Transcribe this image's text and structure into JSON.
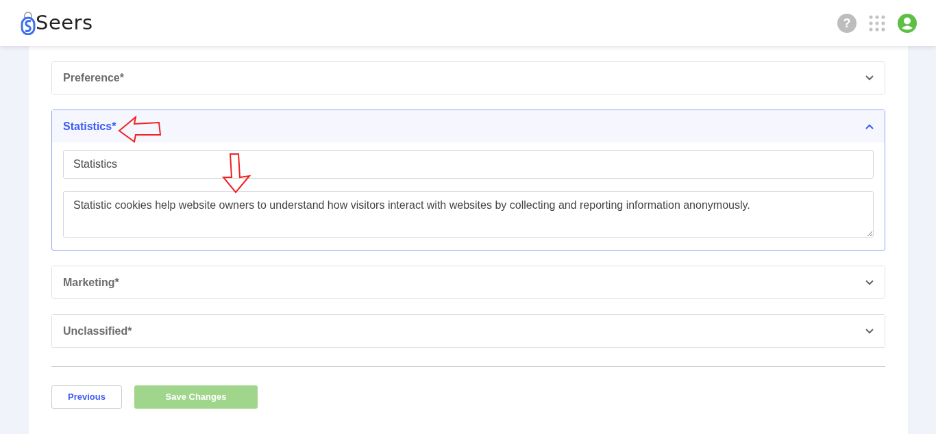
{
  "header": {
    "logo": "Seers",
    "help_icon": "?"
  },
  "sections": [
    {
      "title": "Preference*",
      "expanded": false
    },
    {
      "title": "Statistics*",
      "expanded": true,
      "title_arrow": true,
      "field_arrow": true,
      "name_value": "Statistics",
      "description_value": "Statistic cookies help website owners to understand how visitors interact with websites by collecting and reporting information anonymously."
    },
    {
      "title": "Marketing*",
      "expanded": false
    },
    {
      "title": "Unclassified*",
      "expanded": false
    }
  ],
  "buttons": [
    {
      "label": "Previous",
      "kind": "outline",
      "disabled": false
    },
    {
      "label": "Save Changes",
      "kind": "primary",
      "disabled": true
    }
  ]
}
